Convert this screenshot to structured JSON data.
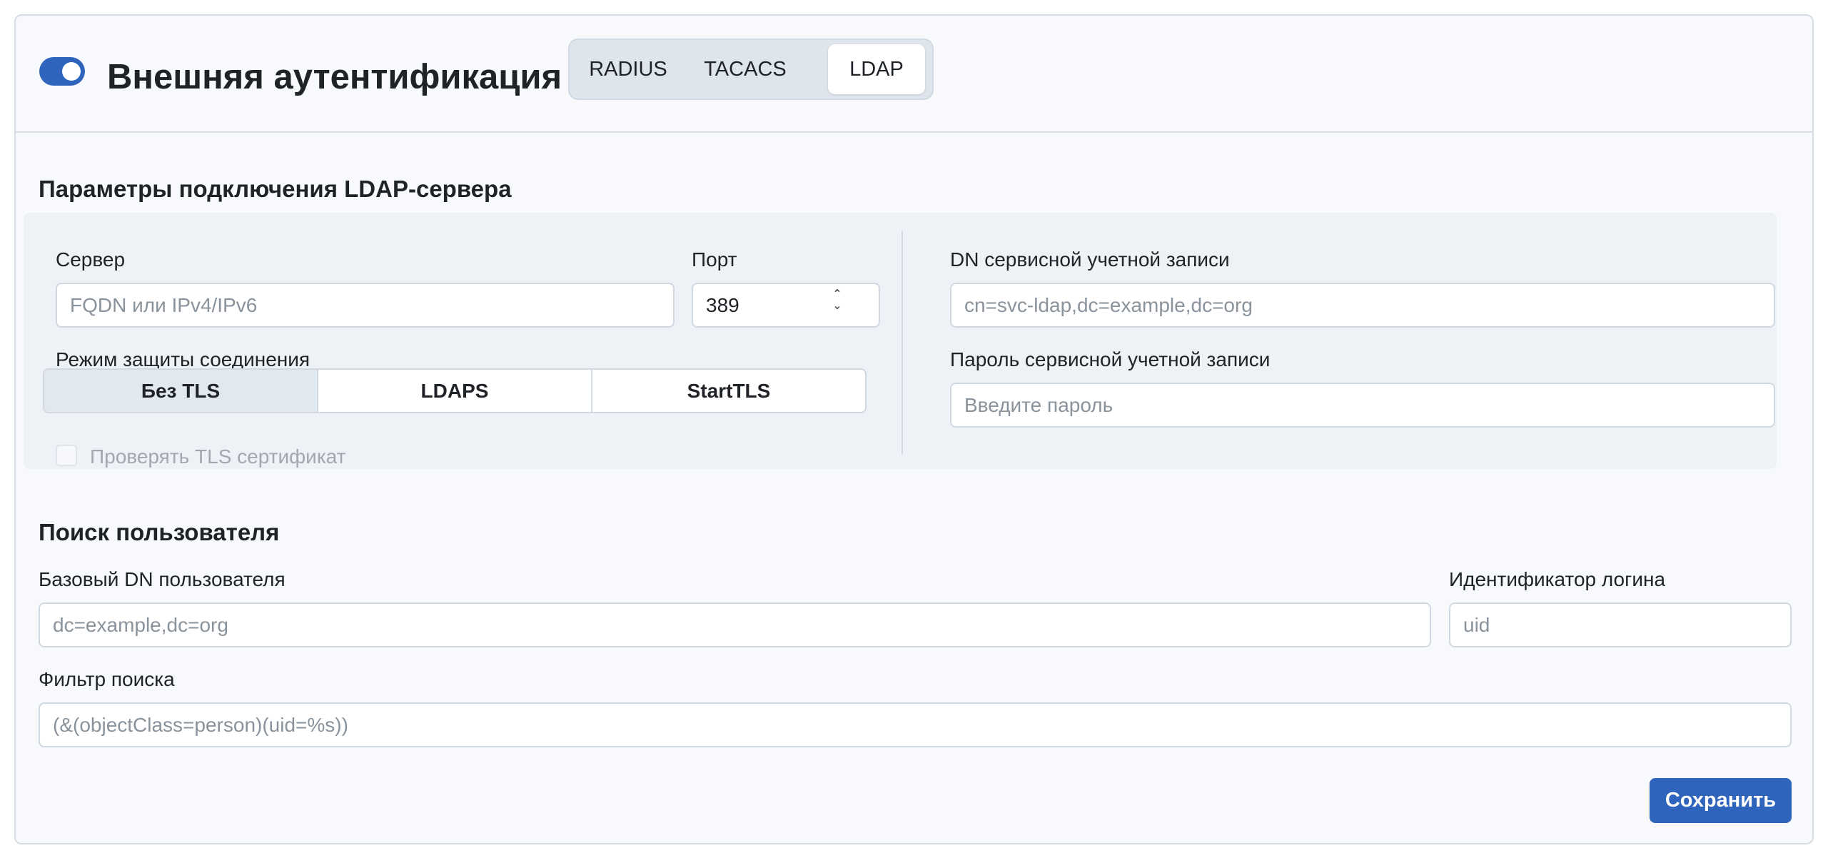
{
  "header": {
    "toggle_on": true,
    "title": "Внешняя аутентификация",
    "tabs": [
      {
        "label": "RADIUS",
        "active": false
      },
      {
        "label": "TACACS",
        "active": false
      },
      {
        "label": "LDAP",
        "active": true
      }
    ]
  },
  "connection": {
    "section_title": "Параметры подключения LDAP-сервера",
    "server": {
      "label": "Сервер",
      "placeholder": "FQDN или IPv4/IPv6",
      "value": ""
    },
    "port": {
      "label": "Порт",
      "value": "389"
    },
    "security_mode": {
      "label": "Режим защиты соединения",
      "options": [
        "Без TLS",
        "LDAPS",
        "StartTLS"
      ],
      "selected": "Без TLS"
    },
    "verify_tls": {
      "label": "Проверять TLS сертификат",
      "checked": false,
      "disabled": true
    },
    "service_dn": {
      "label": "DN сервисной учетной записи",
      "placeholder": "cn=svc-ldap,dc=example,dc=org",
      "value": ""
    },
    "service_password": {
      "label": "Пароль сервисной учетной записи",
      "placeholder": "Введите пароль",
      "value": ""
    }
  },
  "user_search": {
    "section_title": "Поиск пользователя",
    "base_dn": {
      "label": "Базовый DN пользователя",
      "placeholder": "dc=example,dc=org",
      "value": ""
    },
    "login_id": {
      "label": "Идентификатор логина",
      "placeholder": "uid",
      "value": ""
    },
    "filter": {
      "label": "Фильтр поиска",
      "placeholder": "(&(objectClass=person)(uid=%s))",
      "value": ""
    }
  },
  "actions": {
    "save_label": "Сохранить"
  },
  "colors": {
    "accent": "#2f64bd",
    "background": "#f7f9fc",
    "panel": "#eef2f7",
    "border": "#d0d8e1"
  }
}
